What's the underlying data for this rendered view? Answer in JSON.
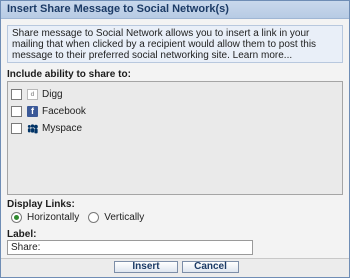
{
  "dialog": {
    "title": "Insert Share Message to Social Network(s)"
  },
  "info": {
    "text": "Share message to Social Network allows you to insert a link in your mailing that when clicked by a recipient would allow them to post this message to their preferred social networking site. ",
    "learn_more": "Learn more..."
  },
  "share": {
    "label": "Include ability to share to:",
    "networks": [
      {
        "label": "Digg",
        "icon": "digg-icon",
        "checked": false
      },
      {
        "label": "Facebook",
        "icon": "facebook-icon",
        "checked": false
      },
      {
        "label": "Myspace",
        "icon": "myspace-icon",
        "checked": false
      }
    ]
  },
  "display_links": {
    "label": "Display Links:",
    "options": [
      "Horizontally",
      "Vertically"
    ],
    "selected": "Horizontally"
  },
  "label_field": {
    "label": "Label:",
    "value": "Share:"
  },
  "buttons": {
    "insert": "Insert",
    "cancel": "Cancel"
  },
  "colors": {
    "title_text": "#1c3b66",
    "facebook_brand": "#3b5998",
    "radio_selected": "#2f8a2f"
  }
}
